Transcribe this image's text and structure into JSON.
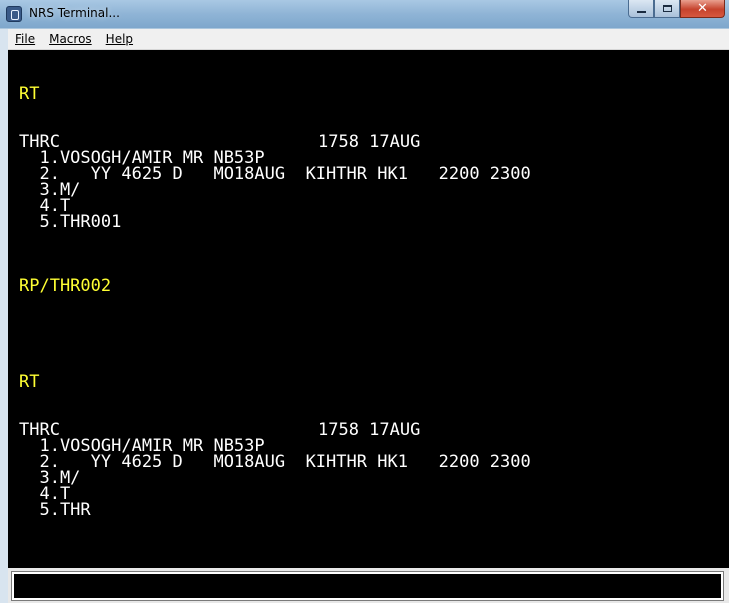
{
  "window": {
    "title": "NRS Terminal...",
    "controls": {
      "minimize": "minimize",
      "maximize": "maximize",
      "close": "✕"
    }
  },
  "menu": [
    {
      "label": "File"
    },
    {
      "label": "Macros"
    },
    {
      "label": "Help"
    }
  ],
  "terminal": {
    "lines": [
      {
        "text": "RT",
        "kind": "cmd"
      },
      {
        "text": "THRC",
        "kind": "out"
      },
      {
        "text": "1758 17AUG",
        "kind": "out"
      },
      {
        "text": "  1.VOSOGH/AMIR MR NB53P",
        "kind": "out"
      },
      {
        "text": "  2.   YY 4625 D   MO18AUG  KIHTHR HK1   2200 2300",
        "kind": "out"
      },
      {
        "text": "  3.M/",
        "kind": "out"
      },
      {
        "text": "  4.T",
        "kind": "out"
      },
      {
        "text": "  5.THR001",
        "kind": "out"
      },
      {
        "text": "RP/THR002",
        "kind": "cmd"
      },
      {
        "text": "RT",
        "kind": "cmd"
      },
      {
        "text": "THRC",
        "kind": "out"
      },
      {
        "text": "1758 17AUG",
        "kind": "out"
      },
      {
        "text": "  1.VOSOGH/AMIR MR NB53P",
        "kind": "out"
      },
      {
        "text": "  2.   YY 4625 D   MO18AUG  KIHTHR HK1   2200 2300",
        "kind": "out"
      },
      {
        "text": "  3.M/",
        "kind": "out"
      },
      {
        "text": "  4.T",
        "kind": "out"
      },
      {
        "text": "  5.THR",
        "kind": "out"
      }
    ]
  },
  "command_input": {
    "value": ""
  },
  "colors": {
    "command_text": "#ffff33",
    "output_text": "#ffffff",
    "background": "#000000"
  }
}
